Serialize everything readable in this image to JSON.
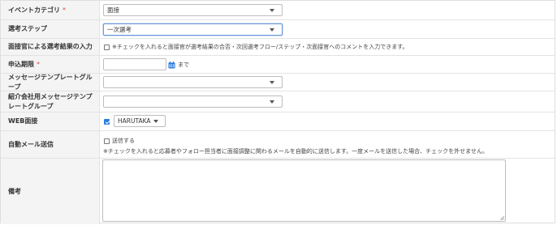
{
  "form": {
    "event_category": {
      "label": "イベントカテゴリ",
      "required_mark": "*",
      "value": "面接"
    },
    "selection_step": {
      "label": "選考ステップ",
      "value": "一次選考"
    },
    "interviewer_input": {
      "label": "面接官による選考結果の入力",
      "checkbox_text": "※チェックを入れると面接官が選考結果の合否・次回選考フロー/ステップ・次面接官へのコメントを入力できます。",
      "checked": false
    },
    "deadline": {
      "label": "申込期限",
      "required_mark": "*",
      "value": "",
      "suffix": "まで"
    },
    "message_template_group": {
      "label": "メッセージテンプレートグループ",
      "value": ""
    },
    "agency_message_template_group": {
      "label": "紹介会社用メッセージテンプレートグループ",
      "value": ""
    },
    "web_interview": {
      "label": "WEB面接",
      "checked": true,
      "provider": "HARUTAKA"
    },
    "auto_mail": {
      "label": "自動メール送信",
      "checkbox_label": "送信する",
      "checked": false,
      "note": "※チェックを入れると応募者やフォロー担当者に面接調整に関わるメールを自動的に送信します。一度メールを送信した場合、チェックを外せません。"
    },
    "remarks": {
      "label": "備考",
      "value": ""
    }
  },
  "colors": {
    "accent": "#2d7be0",
    "required": "#e04c4c",
    "label_bg": "#f4f4f4",
    "border": "#e3e3e3"
  }
}
